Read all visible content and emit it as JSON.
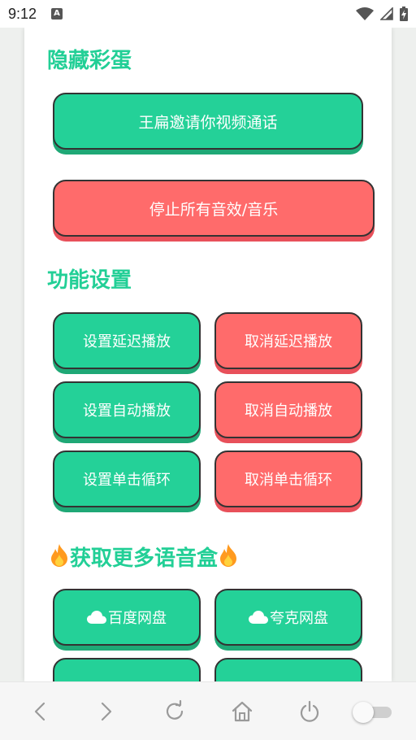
{
  "status_bar": {
    "time": "9:12",
    "notification_icon": "a-notification-icon",
    "wifi_icon": "wifi-icon",
    "signal_icon": "signal-icon",
    "battery_icon": "battery-charging-icon"
  },
  "sections": {
    "easter_egg": {
      "title": "隐藏彩蛋",
      "video_call_button": "王扁邀请你视频通话",
      "stop_all_button": "停止所有音效/音乐"
    },
    "settings": {
      "title": "功能设置",
      "buttons": [
        {
          "label": "设置延迟播放",
          "color": "green"
        },
        {
          "label": "取消延迟播放",
          "color": "red"
        },
        {
          "label": "设置自动播放",
          "color": "green"
        },
        {
          "label": "取消自动播放",
          "color": "red"
        },
        {
          "label": "设置单击循环",
          "color": "green"
        },
        {
          "label": "取消单击循环",
          "color": "red"
        }
      ]
    },
    "more": {
      "title": "获取更多语音盒",
      "icon": "fire-icon",
      "buttons": [
        {
          "label": "百度网盘",
          "icon": "cloud-icon"
        },
        {
          "label": "夸克网盘",
          "icon": "cloud-icon"
        }
      ]
    }
  },
  "nav_bar": {
    "icons": [
      "back-icon",
      "forward-icon",
      "refresh-icon",
      "home-icon",
      "power-icon",
      "toggle-switch"
    ]
  },
  "colors": {
    "accent_green": "#24d198",
    "title_green": "#22cf96",
    "danger_red": "#ff6b6b"
  }
}
